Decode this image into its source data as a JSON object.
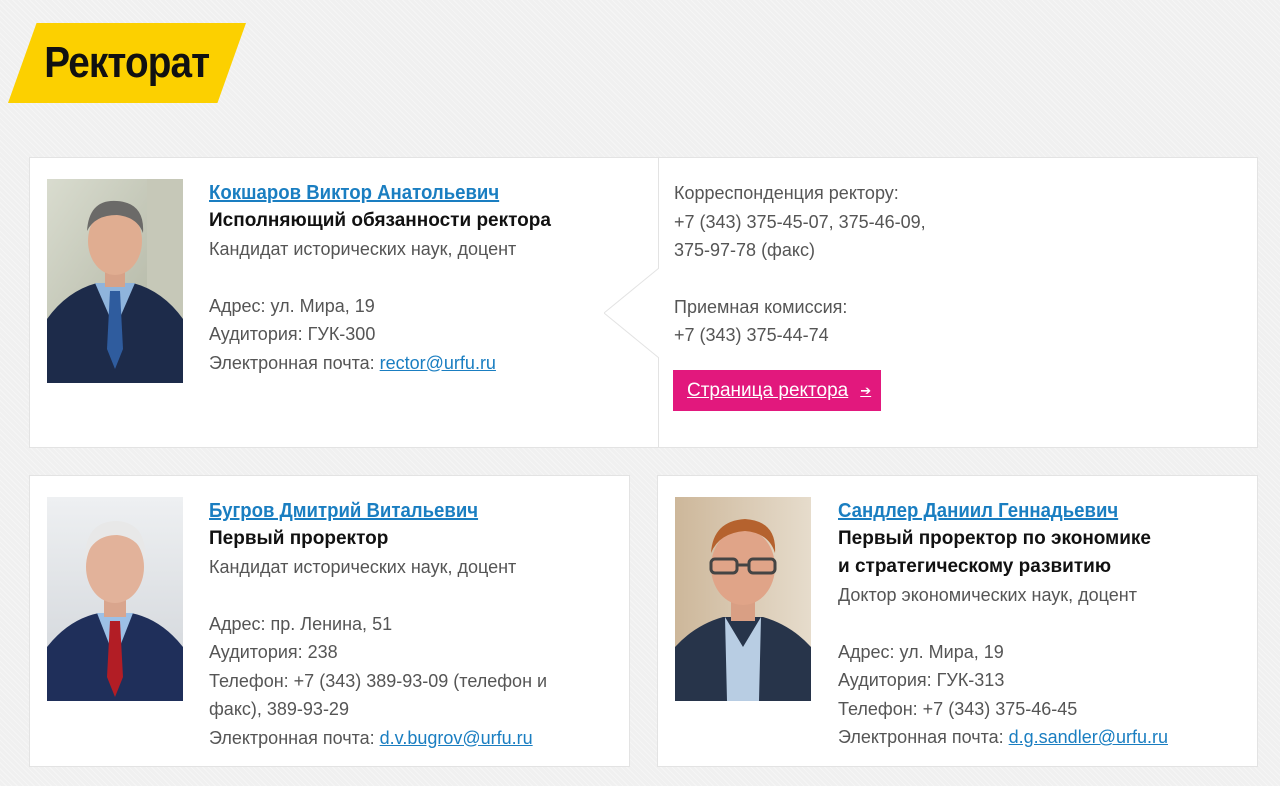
{
  "page": {
    "title": "Ректорат",
    "accent": "#fcd000",
    "link_color": "#1a7ec1",
    "button_color": "#e2187d"
  },
  "rector": {
    "name": "Кокшаров Виктор Анатольевич",
    "role": "Исполняющий обязанности ректора",
    "degree": "Кандидат исторических наук, доцент",
    "address": "Адрес: ул. Мира, 19",
    "room": "Аудитория: ГУК-300",
    "email_label": "Электронная почта: ",
    "email": "rector@urfu.ru",
    "corr_label": "Корреспонденция ректору:",
    "corr_phone_1": "+7 (343) 375-45-07, 375-46-09,",
    "corr_phone_2": "375-97-78 (факс)",
    "admission_label": "Приемная комиссия:",
    "admission_phone": "+7 (343) 375-44-74",
    "page_button": "Страница ректора",
    "button_icon": "arrow-right-icon"
  },
  "bugrov": {
    "name": "Бугров Дмитрий Витальевич",
    "role": "Первый проректор",
    "degree": "Кандидат исторических наук, доцент",
    "address": "Адрес: пр. Ленина, 51",
    "room": "Аудитория: 238",
    "phone_1": "Телефон: +7 (343) 389-93-09 (телефон и",
    "phone_2": "факс), 389-93-29",
    "email_label": "Электронная почта: ",
    "email": "d.v.bugrov@urfu.ru"
  },
  "sandler": {
    "name": "Сандлер Даниил Геннадьевич",
    "role_1": "Первый проректор по экономике",
    "role_2": "и стратегическому развитию",
    "degree": "Доктор экономических наук, доцент",
    "address": "Адрес: ул. Мира, 19",
    "room": "Аудитория: ГУК-313",
    "phone": "Телефон: +7 (343) 375-46-45",
    "email_label": "Электронная почта: ",
    "email": "d.g.sandler@urfu.ru"
  }
}
